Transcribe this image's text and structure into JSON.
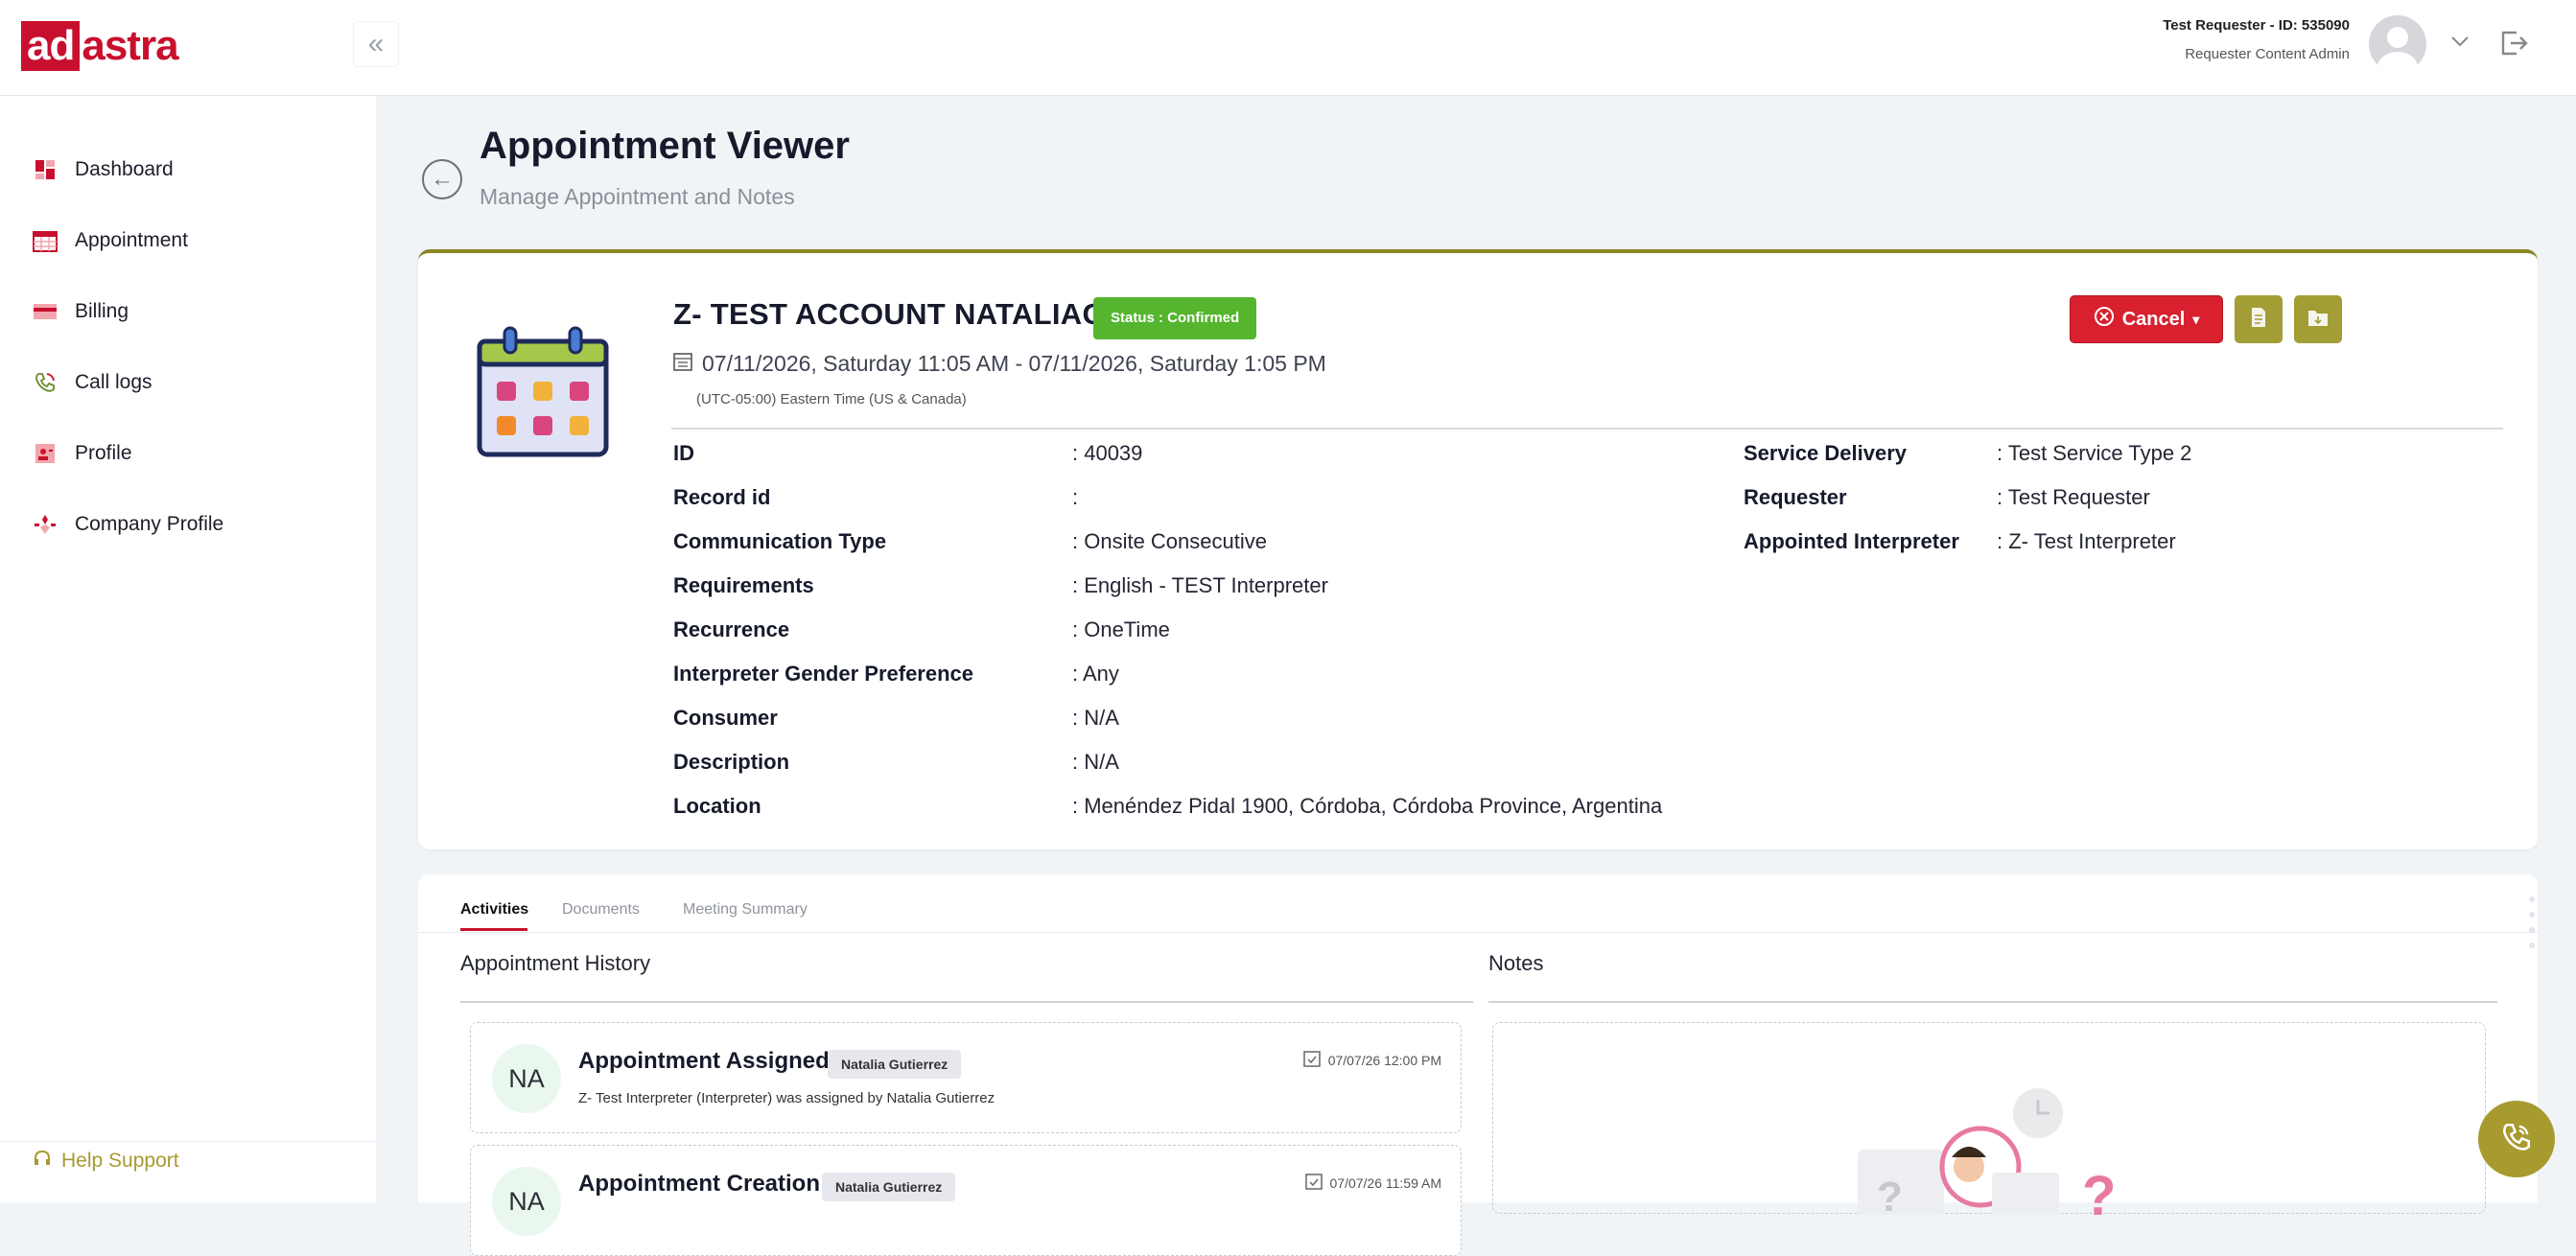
{
  "brand": {
    "part1": "ad",
    "part2": "astra"
  },
  "header": {
    "user_name": "Test Requester - ID: 535090",
    "user_role": "Requester Content Admin"
  },
  "sidebar": {
    "items": [
      {
        "label": "Dashboard",
        "icon": "dashboard-icon"
      },
      {
        "label": "Appointment",
        "icon": "calendar-icon"
      },
      {
        "label": "Billing",
        "icon": "billing-icon"
      },
      {
        "label": "Call logs",
        "icon": "phone-icon"
      },
      {
        "label": "Profile",
        "icon": "profile-icon"
      },
      {
        "label": "Company Profile",
        "icon": "company-icon"
      }
    ],
    "help": "Help Support"
  },
  "page": {
    "title": "Appointment Viewer",
    "subtitle": "Manage Appointment and Notes"
  },
  "appointment": {
    "account": "Z- TEST ACCOUNT NATALIAG",
    "status": "Status : Confirmed",
    "datetime": "07/11/2026, Saturday 11:05 AM - 07/11/2026, Saturday 1:05 PM",
    "timezone": "(UTC-05:00) Eastern Time (US & Canada)",
    "cancel_label": "Cancel",
    "colors": {
      "status": "#55b52e",
      "cancel": "#d8202f",
      "accent": "#a39d35"
    },
    "left_fields": [
      {
        "label": "ID",
        "value": ": 40039"
      },
      {
        "label": "Record id",
        "value": ":"
      },
      {
        "label": "Communication Type",
        "value": ": Onsite Consecutive"
      },
      {
        "label": "Requirements",
        "value": ": English - TEST Interpreter"
      },
      {
        "label": "Recurrence",
        "value": ": OneTime"
      },
      {
        "label": "Interpreter Gender Preference",
        "value": ": Any"
      },
      {
        "label": "Consumer",
        "value": ": N/A"
      },
      {
        "label": "Description",
        "value": ": N/A"
      },
      {
        "label": "Location",
        "value": ": Menéndez Pidal 1900, Córdoba, Córdoba Province, Argentina"
      }
    ],
    "right_fields": [
      {
        "label": "Service Delivery",
        "value": ": Test Service Type 2"
      },
      {
        "label": "Requester",
        "value": ": Test Requester"
      },
      {
        "label": "Appointed Interpreter",
        "value": ": Z- Test Interpreter"
      }
    ]
  },
  "tabs": [
    "Activities",
    "Documents",
    "Meeting Summary"
  ],
  "history": {
    "title": "Appointment History",
    "items": [
      {
        "initials": "NA",
        "title": "Appointment Assigned",
        "user": "Natalia Gutierrez",
        "desc": "Z- Test Interpreter (Interpreter) was assigned by Natalia Gutierrez",
        "time": "07/07/26 12:00 PM"
      },
      {
        "initials": "NA",
        "title": "Appointment Creation",
        "user": "Natalia Gutierrez",
        "desc": "",
        "time": "07/07/26 11:59 AM"
      }
    ]
  },
  "notes": {
    "title": "Notes"
  }
}
